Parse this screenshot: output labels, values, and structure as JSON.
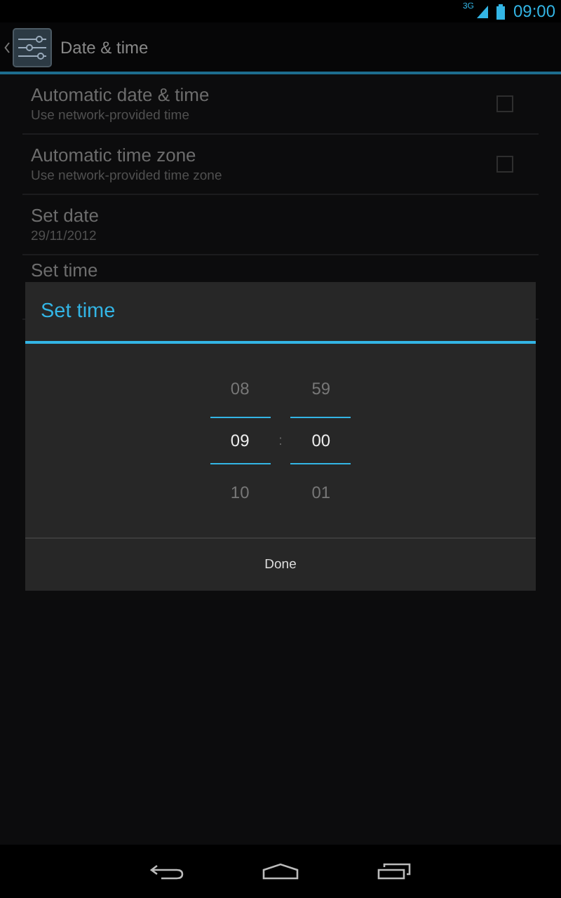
{
  "status_bar": {
    "network": "3G",
    "time": "09:00"
  },
  "action_bar": {
    "title": "Date & time"
  },
  "settings": [
    {
      "kind": "checkbox",
      "title": "Automatic date & time",
      "summary": "Use network-provided time",
      "checked": false
    },
    {
      "kind": "checkbox",
      "title": "Automatic time zone",
      "summary": "Use network-provided time zone",
      "checked": false
    },
    {
      "kind": "plain",
      "title": "Set date",
      "summary": "29/11/2012"
    },
    {
      "kind": "plain",
      "title": "Set time"
    }
  ],
  "dialog": {
    "title": "Set time",
    "separator": ":",
    "button": "Done",
    "pickers": [
      {
        "above": "08",
        "value": "09",
        "below": "10"
      },
      {
        "above": "59",
        "value": "00",
        "below": "01"
      }
    ]
  }
}
